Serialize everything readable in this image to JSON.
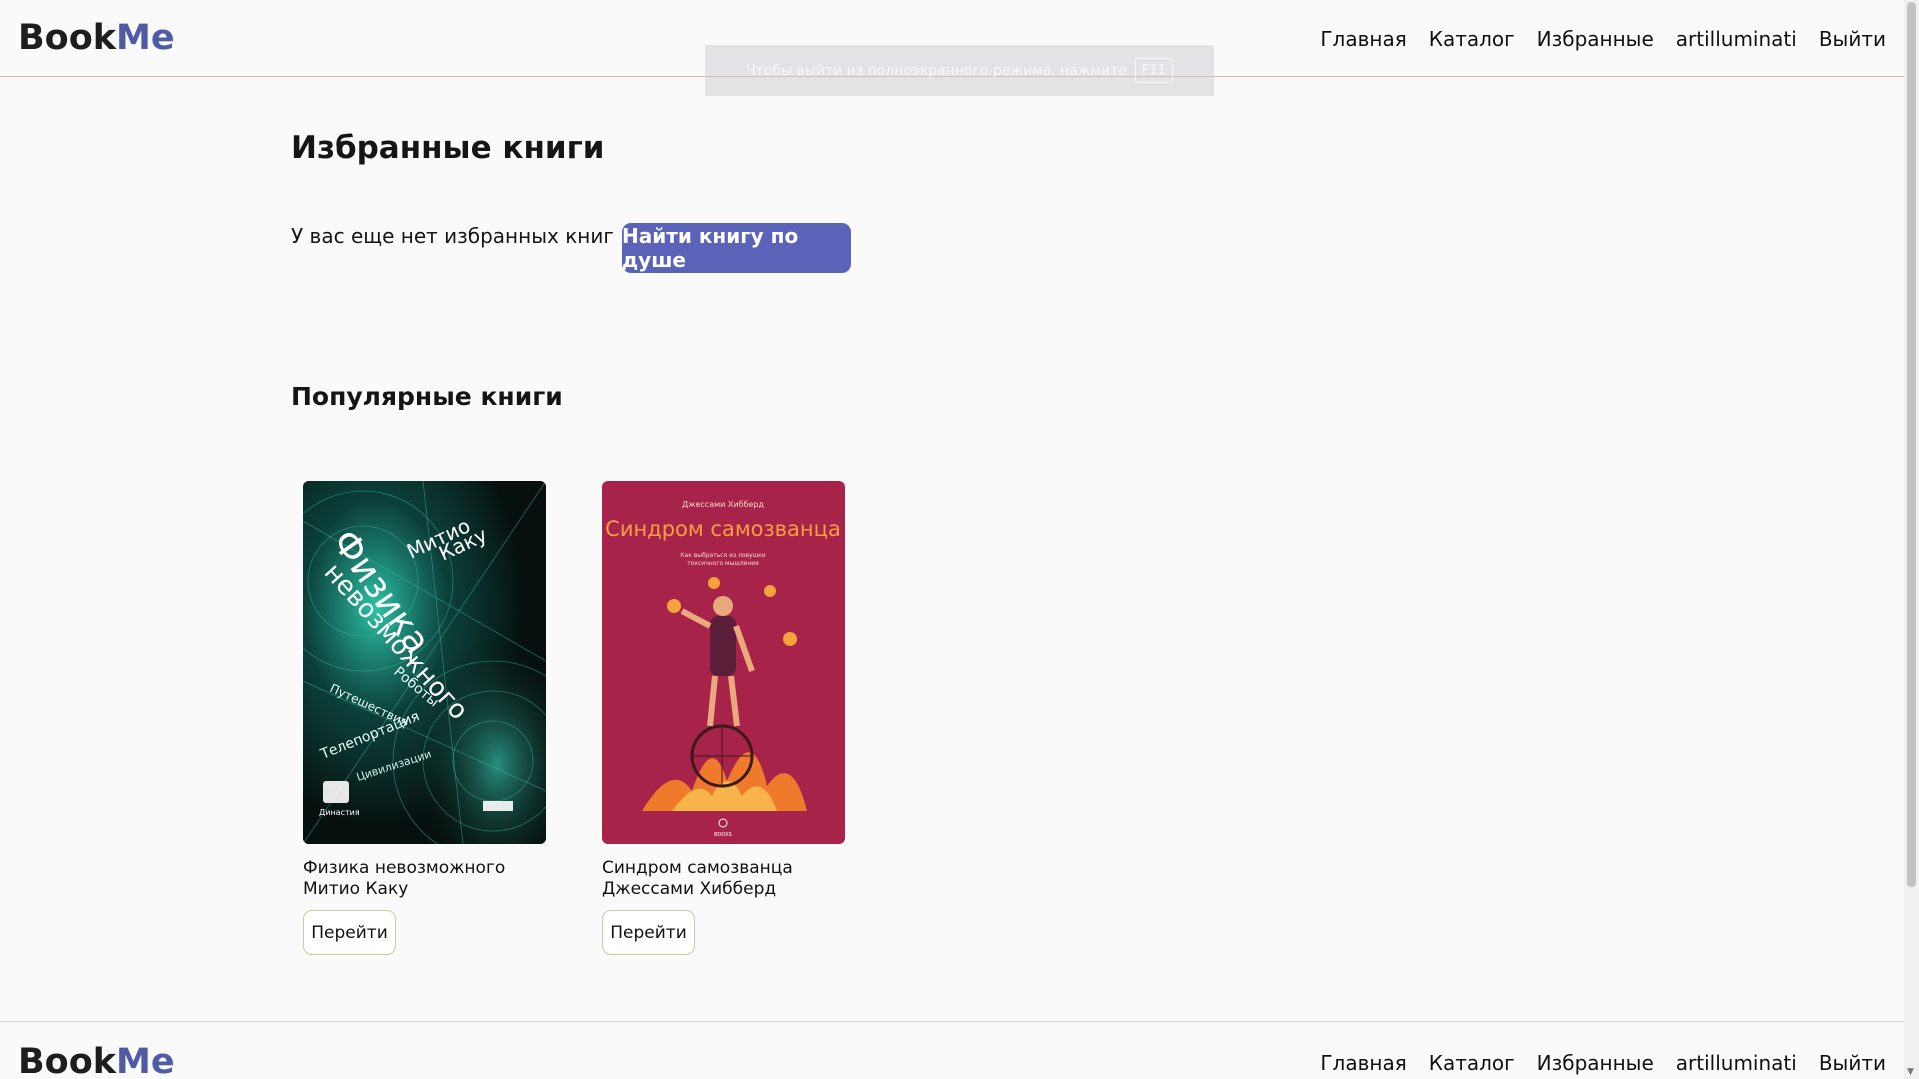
{
  "header": {
    "logo_book": "Book",
    "logo_me": "Me",
    "nav": [
      "Главная",
      "Каталог",
      "Избранные",
      "artilluminati",
      "Выйти"
    ]
  },
  "fullscreen_toast": {
    "text": "Чтобы выйти из полноэкранного режима, нажмите",
    "key": "F11"
  },
  "favorites": {
    "title": "Избранные книги",
    "empty_text": "У вас еще нет избранных книг",
    "find_button": "Найти книгу по душе"
  },
  "popular": {
    "title": "Популярные книги",
    "books": [
      {
        "title": "Физика невозможного",
        "author": "Митио Каку",
        "button": "Перейти",
        "cover": {
          "author": "Митио Каку",
          "title_line1": "Физика",
          "title_line2": "невозможного",
          "words": [
            "Роботы",
            "Путешествия",
            "Телепортация",
            "Цивилизации",
            "Династия"
          ]
        }
      },
      {
        "title": "Синдром самозванца",
        "author": "Джессами Хибберд",
        "button": "Перейти",
        "cover": {
          "author": "Джессами Хибберд",
          "title": "Синдром самозванца",
          "subtitle": "Как выбраться из ловушки токсичного мышления"
        }
      }
    ]
  },
  "colors": {
    "accent": "#5a63b8",
    "logo_me": "#4f5ba6",
    "cover1_bg": "#0b1b1a",
    "cover2_bg": "#a8234a"
  }
}
